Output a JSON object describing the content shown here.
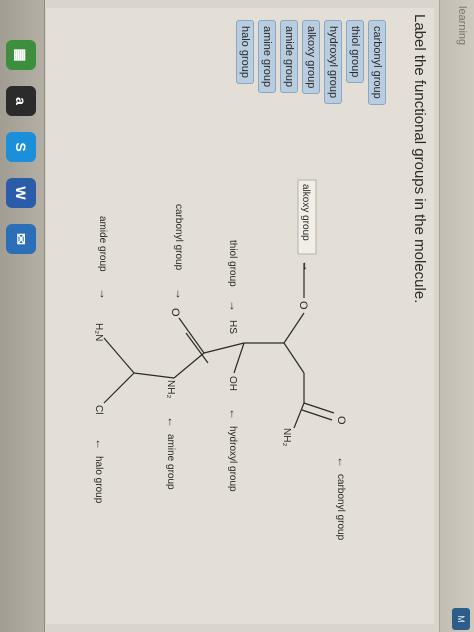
{
  "window": {
    "brand": "learning",
    "corner_button": "M"
  },
  "question": {
    "title": "Label the functional groups in the molecule."
  },
  "answer_bank": {
    "items": [
      "carbonyl group",
      "thiol group",
      "hydroxyl group",
      "alkoxy group",
      "amide group",
      "amine group",
      "halo group"
    ]
  },
  "labels_placed": {
    "alkoxy": "alkoxy group",
    "thiol": "thiol group",
    "carbonyl_left": "carbonyl group",
    "amide": "amide group",
    "carbonyl_right": "carbonyl group",
    "hydroxyl": "hydroxyl group",
    "amine": "amine group",
    "halo": "halo group"
  },
  "molecule_atoms": {
    "o_ether": "O",
    "o_top": "O",
    "nh2_top": "NH₂",
    "hs": "HS",
    "oh": "OH",
    "o_mid": "O",
    "nh2_mid": "NH₂",
    "h2n": "H₂N",
    "cl": "Cl"
  },
  "arrows": {
    "right": "→",
    "left": "←"
  },
  "dock": {
    "icons": [
      "calendar-icon",
      "amazon-icon",
      "skype-icon",
      "word-icon",
      "outlook-icon"
    ],
    "colors": [
      "#3d8f3d",
      "#2b2b2b",
      "#1b8fd9",
      "#2a5caa",
      "#2a6fb8"
    ],
    "glyphs": [
      "▦",
      "a",
      "S",
      "W",
      "✉"
    ]
  }
}
